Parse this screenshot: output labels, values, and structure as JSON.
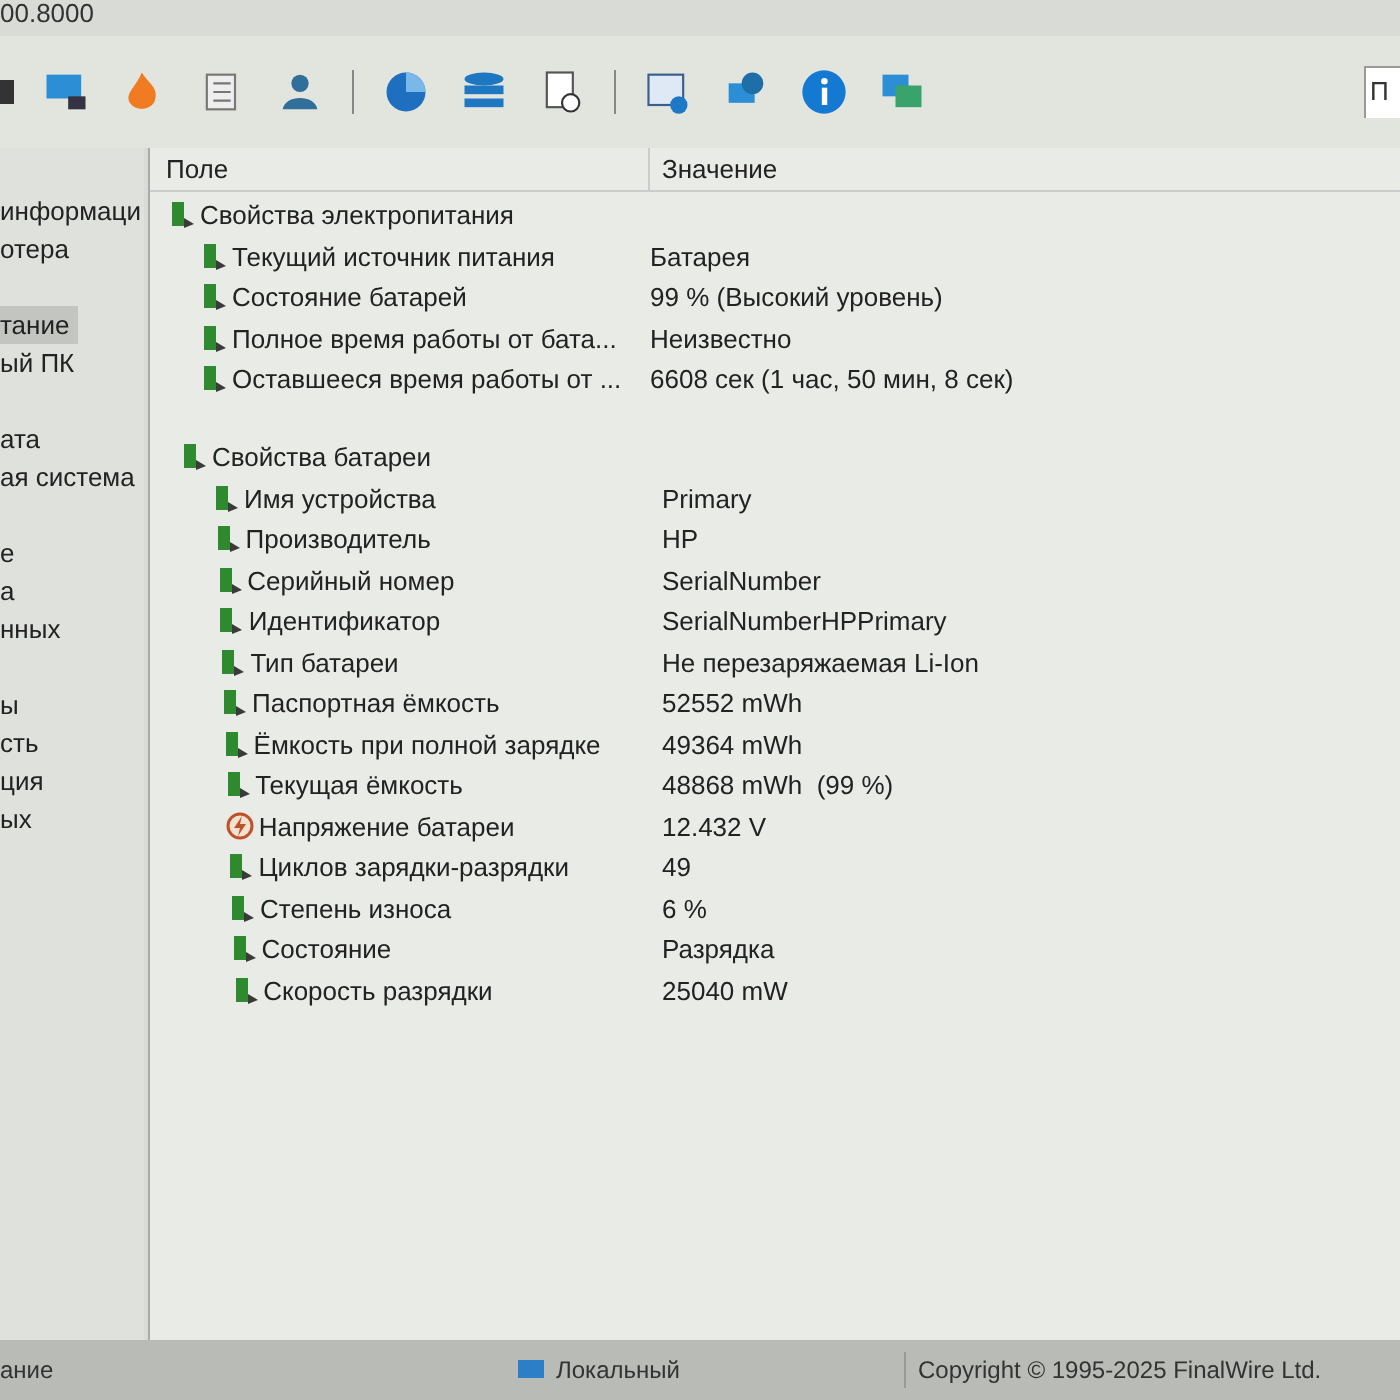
{
  "window": {
    "title": "00.8000"
  },
  "toolbar": {
    "search_placeholder": "П"
  },
  "sidebar": {
    "groups": [
      [
        {
          "label": "информаци",
          "selected": false
        },
        {
          "label": "отера",
          "selected": false
        }
      ],
      [
        {
          "label": "тание",
          "selected": true
        },
        {
          "label": "ый ПК",
          "selected": false
        }
      ],
      [
        {
          "label": "ата",
          "selected": false
        },
        {
          "label": "ая система",
          "selected": false
        }
      ],
      [
        {
          "label": "е",
          "selected": false
        },
        {
          "label": "а",
          "selected": false
        },
        {
          "label": "нных",
          "selected": false
        }
      ],
      [
        {
          "label": "ы",
          "selected": false
        },
        {
          "label": "сть",
          "selected": false
        },
        {
          "label": "ция",
          "selected": false
        },
        {
          "label": "ых",
          "selected": false
        }
      ]
    ]
  },
  "table": {
    "columns": [
      "Поле",
      "Значение"
    ],
    "groups": [
      {
        "title": "Свойства электропитания",
        "rows": [
          {
            "kind": "battery",
            "field": "Текущий источник питания",
            "value": "Батарея"
          },
          {
            "kind": "battery",
            "field": "Состояние батарей",
            "value": "99 % (Высокий уровень)"
          },
          {
            "kind": "battery",
            "field": "Полное время работы от бата...",
            "value": "Неизвестно"
          },
          {
            "kind": "battery",
            "field": "Оставшееся время работы от ...",
            "value": "6608 сек (1 час, 50 мин, 8 сек)"
          }
        ]
      },
      {
        "title": "Свойства батареи",
        "rows": [
          {
            "kind": "battery",
            "field": "Имя устройства",
            "value": "Primary"
          },
          {
            "kind": "battery",
            "field": "Производитель",
            "value": "HP"
          },
          {
            "kind": "battery",
            "field": "Серийный номер",
            "value": "SerialNumber"
          },
          {
            "kind": "battery",
            "field": "Идентификатор",
            "value": "SerialNumberHPPrimary"
          },
          {
            "kind": "battery",
            "field": "Тип батареи",
            "value": "Не перезаряжаемая Li-Ion"
          },
          {
            "kind": "battery",
            "field": "Паспортная ёмкость",
            "value": "52552 mWh"
          },
          {
            "kind": "battery",
            "field": "Ёмкость при полной зарядке",
            "value": "49364 mWh"
          },
          {
            "kind": "battery",
            "field": "Текущая ёмкость",
            "value": "48868 mWh  (99 %)"
          },
          {
            "kind": "voltage",
            "field": "Напряжение батареи",
            "value": "12.432 V"
          },
          {
            "kind": "battery",
            "field": "Циклов зарядки-разрядки",
            "value": "49"
          },
          {
            "kind": "battery",
            "field": "Степень износа",
            "value": "6 %"
          },
          {
            "kind": "battery",
            "field": "Состояние",
            "value": "Разрядка"
          },
          {
            "kind": "battery",
            "field": "Скорость разрядки",
            "value": "25040 mW"
          }
        ]
      }
    ]
  },
  "status_bar": {
    "left": "ание",
    "middle": "Локальный",
    "right": "Copyright © 1995-2025 FinalWire Ltd."
  }
}
